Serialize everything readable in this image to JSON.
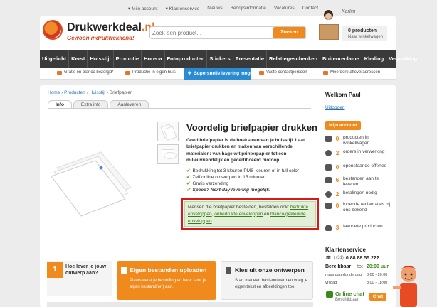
{
  "top_nav": {
    "items": [
      "Mijn account",
      "Klantenservice",
      "Nieuws",
      "Bedrijfsinformatie",
      "Vacatures",
      "Contact"
    ]
  },
  "brand": {
    "name": "Drukwerkdeal",
    "suffix": ".nl",
    "tagline": "Gewoon indrukwekkend!"
  },
  "search": {
    "placeholder": "Zoek een product...",
    "button_label": "Zoeken"
  },
  "assistant_name": "Karlijn",
  "cart": {
    "count": "0",
    "count_label": "producten",
    "subtitle": "Naar winkelwagen"
  },
  "main_nav": {
    "items": [
      "Uitgelicht",
      "Kerst",
      "Huisstijl",
      "Promotie",
      "Horeca",
      "Fotoproducten",
      "Stickers",
      "Presentatie",
      "Relatiegeschenken",
      "Buitenreclame",
      "Kleding",
      "Verpakking"
    ]
  },
  "usp_bar": {
    "items": [
      "Gratis en blanco bezorgd*",
      "Productie in eigen huis",
      "Supersnelle levering mogelijk",
      "Vaste contactpersoon",
      "Meerdere afleveradressen"
    ],
    "active_index": 2
  },
  "breadcrumb": {
    "items": [
      "Home",
      "Producten",
      "Huisstijl"
    ],
    "current": "Briefpapier",
    "separator": "›"
  },
  "tabs": {
    "items": [
      "Info",
      "Extra info",
      "Aanleveren"
    ],
    "active_index": 0
  },
  "product": {
    "title": "Voordelig briefpapier drukken",
    "intro": "Goed briefpapier is de hoeksteen van je huisstijl. Laat briefpapier drukken en maken van verschillende materialen: van hagelwit printerpapier tot een milieuvriendelijk en gecertificeerd biotoop.",
    "bullets": [
      "Bedrukking tot 3 kleuren PMS-kleuren of in full color",
      "Zelf online ontwerpen in 15 minuten",
      "Gratis verzending",
      "Speed? Next-day levering mogelijk!"
    ],
    "notice": {
      "prefix": "Mensen die briefpapier bestelden, bestelden ook: ",
      "links": [
        "bedrukte enveloppen",
        "onbedrukte enveloppen",
        "blanco/gekleurde enveloppen"
      ],
      "join_comma": ", ",
      "join_and": " en ",
      "suffix": "."
    }
  },
  "sidebar": {
    "welcome": "Welkom Paul",
    "logout": "Uitloggen",
    "account_button": "Mijn account",
    "stats": [
      {
        "icon": "cart-icon",
        "num": "0",
        "text": "producten in winkelwagen"
      },
      {
        "icon": "clock-icon",
        "num": "2",
        "text": "orders in verwerking"
      },
      {
        "icon": "document-icon",
        "num": "0",
        "text": "openstaande offertes"
      },
      {
        "icon": "bars-icon",
        "num": "6",
        "text": "bestanden aan te leveren"
      },
      {
        "icon": "coins-icon",
        "num": "2",
        "text": "betalingen nodig"
      },
      {
        "icon": "alert-icon",
        "num": "0",
        "text": "lopende reclamaties bij ons bekend"
      },
      {
        "icon": "heart-icon",
        "num": "3",
        "text": "favoriete producten"
      }
    ],
    "customer_service": {
      "title": "Klantenservice",
      "country_code": "(+31)",
      "phone": "0 88 88 55 222",
      "available_label": "Bereikbaar",
      "available_to": "tot",
      "available_time": "20:00 uur",
      "hours": [
        {
          "days": "maandag-donderdag",
          "time": "8:00 - 20:00"
        },
        {
          "days": "vrijdag",
          "time": "8:00 - 18:00"
        }
      ]
    },
    "chat": {
      "title": "Online chat",
      "subtitle": "Beschikbaar",
      "button": "Chat"
    }
  },
  "bottom_cards": {
    "howto": {
      "number": "1",
      "text": "Hoe lever je jouw ontwerp aan?"
    },
    "upload": {
      "title": "Eigen bestanden uploaden",
      "text": "Plaats eerst je bestelling en lever later je eigen bestand(en) aan."
    },
    "choose": {
      "title": "Kies uit onze ontwerpen",
      "text": "Start met een basisontwerp en voeg je eigen tekst en afbeeldingen toe."
    }
  },
  "colors": {
    "accent": "#f08a1c",
    "nav_bg": "#3a3a3a",
    "usp_active": "#2a8bd3",
    "notice_border": "#d51a1a",
    "notice_bg": "#e3efd6",
    "link": "#2a6fb0"
  }
}
